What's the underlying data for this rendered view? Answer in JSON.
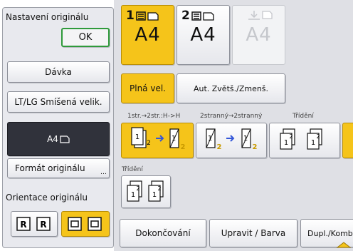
{
  "left_panel": {
    "title": "Nastavení originálu",
    "ok_label": "OK",
    "batch_label": "Dávka",
    "mixed_size_label": "LT/LG Smíšená velik.",
    "current_format_label": "A4",
    "format_button_label": "Formát originálu",
    "orientation_title": "Orientace originálu"
  },
  "trays": [
    {
      "number": "1",
      "size": "A4"
    },
    {
      "number": "2",
      "size": "A4"
    },
    {
      "number": "",
      "size": "A4"
    }
  ],
  "zoom": {
    "full_size_label": "Plná vel.",
    "auto_reduce_label": "Aut. Zvětš./Zmenš."
  },
  "duplex_labels": {
    "one_to_two": "1str.→2str.:H->H",
    "two_to_two": "2stranný→2stranný",
    "sort": "Třídění",
    "sort2": "Třídění"
  },
  "bottom_tabs": {
    "finishing": "Dokončování",
    "edit_color": "Upravit / Barva",
    "duplex_combine": "Dupl./Komb"
  },
  "colors": {
    "selected": "#f5c41a",
    "ok_border": "#2f9a3b",
    "arrow_blue": "#3457d8"
  }
}
